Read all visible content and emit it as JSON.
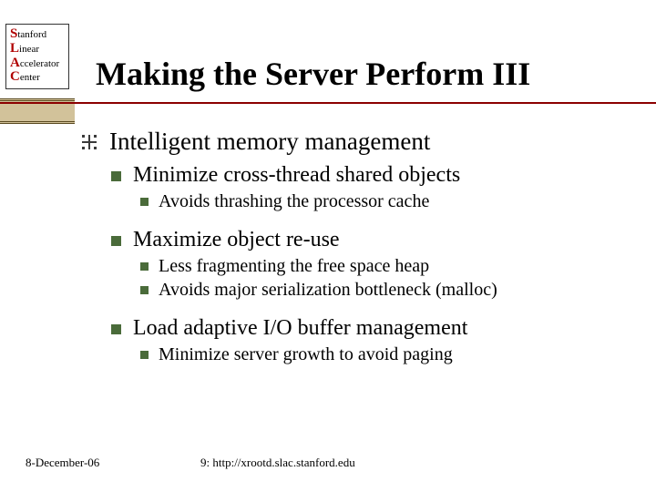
{
  "logo": {
    "line1_cap": "S",
    "line1_rest": "tanford",
    "line2_cap": "L",
    "line2_rest": "inear",
    "line3_cap": "A",
    "line3_rest": "ccelerator",
    "line4_cap": "C",
    "line4_rest": "enter"
  },
  "title": "Making the Server Perform III",
  "content": {
    "lvl1": "Intelligent memory management",
    "items": [
      {
        "text": "Minimize cross-thread shared objects",
        "sub": [
          "Avoids thrashing the processor cache"
        ]
      },
      {
        "text": "Maximize object re-use",
        "sub": [
          "Less fragmenting the free space heap",
          "Avoids major serialization bottleneck (malloc)"
        ]
      },
      {
        "text": "Load adaptive I/O buffer management",
        "sub": [
          "Minimize server growth to avoid paging"
        ]
      }
    ]
  },
  "footer": {
    "date": "8-December-06",
    "ref": "9: http://xrootd.slac.stanford.edu"
  }
}
